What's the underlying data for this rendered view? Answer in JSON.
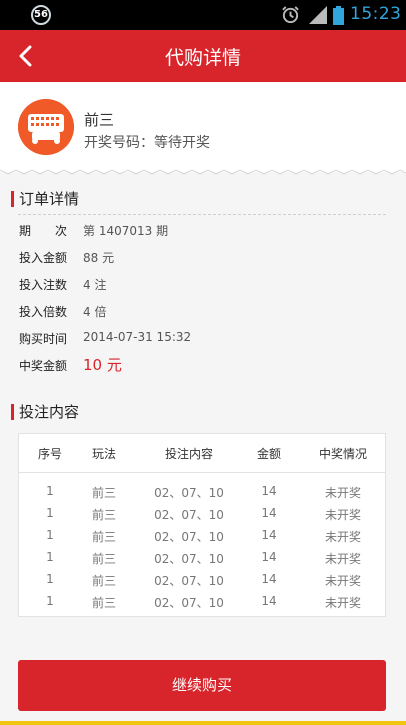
{
  "status_bar": {
    "badge": "56",
    "time": "15:23",
    "icons": [
      "alarm-icon",
      "signal-icon",
      "battery-icon"
    ]
  },
  "app_bar": {
    "title": "代购详情",
    "back_icon": "chevron-left-icon"
  },
  "lottery": {
    "name": "前三",
    "draw_status": "开奖号码：等待开奖",
    "logo_icon": "lottery-machine-icon"
  },
  "order": {
    "heading": "订单详情",
    "rows": [
      {
        "label": "期　　次",
        "value": "第 1407013 期"
      },
      {
        "label": "投入金额",
        "value": "88 元"
      },
      {
        "label": "投入注数",
        "value": "4 注"
      },
      {
        "label": "投入倍数",
        "value": "4 倍"
      },
      {
        "label": "购买时间",
        "value": "2014-07-31 15:32"
      },
      {
        "label": "中奖金额",
        "value": "10 元"
      }
    ]
  },
  "bets": {
    "heading": "投注内容",
    "columns": [
      "序号",
      "玩法",
      "投注内容",
      "金额",
      "中奖情况"
    ],
    "rows": [
      [
        "1",
        "前三",
        "02、07、10",
        "14",
        "未开奖"
      ],
      [
        "1",
        "前三",
        "02、07、10",
        "14",
        "未开奖"
      ],
      [
        "1",
        "前三",
        "02、07、10",
        "14",
        "未开奖"
      ],
      [
        "1",
        "前三",
        "02、07、10",
        "14",
        "未开奖"
      ],
      [
        "1",
        "前三",
        "02、07、10",
        "14",
        "未开奖"
      ],
      [
        "1",
        "前三",
        "02、07、10",
        "14",
        "未开奖"
      ]
    ]
  },
  "actions": {
    "continue_label": "继续购买"
  },
  "colors": {
    "primary_red": "#d8242b",
    "logo_orange": "#f05a28",
    "status_time_blue": "#30a6dc",
    "bottom_accent": "#f1c40f"
  }
}
